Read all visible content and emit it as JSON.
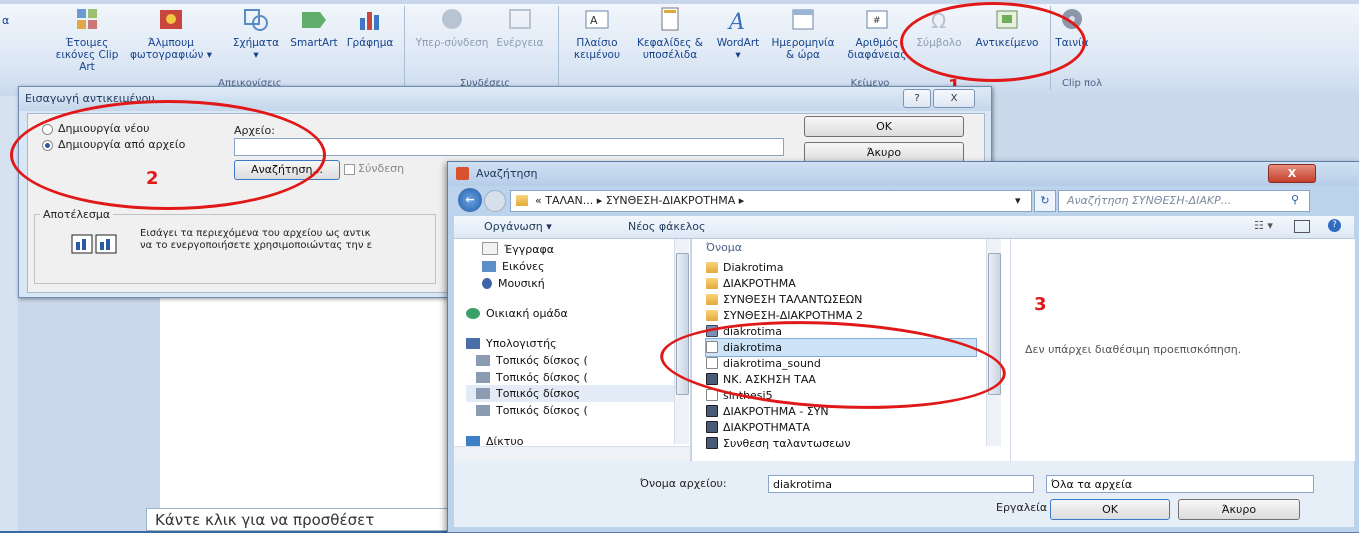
{
  "ribbon": {
    "items": [
      {
        "label": "Έτοιμες εικόνες Clip Art",
        "line1": "Έτοιμες",
        "line2": "εικόνες Clip Art"
      },
      {
        "label": "Άλμπουμ φωτογραφιών",
        "line1": "Άλμπουμ",
        "line2": "φωτογραφιών ▾"
      },
      {
        "label": "Σχήματα",
        "line1": "Σχήματα",
        "line2": "▾"
      },
      {
        "label": "SmartArt",
        "line1": "SmartArt",
        "line2": ""
      },
      {
        "label": "Γράφημα",
        "line1": "Γράφημα",
        "line2": ""
      },
      {
        "label": "Υπερ-σύνδεση",
        "line1": "Υπερ-σύνδεση",
        "line2": ""
      },
      {
        "label": "Ενέργεια",
        "line1": "Ενέργεια",
        "line2": ""
      },
      {
        "label": "Πλαίσιο κειμένου",
        "line1": "Πλαίσιο",
        "line2": "κειμένου"
      },
      {
        "label": "Κεφαλίδες & υποσέλιδα",
        "line1": "Κεφαλίδες &",
        "line2": "υποσέλιδα"
      },
      {
        "label": "WordArt",
        "line1": "WordArt",
        "line2": "▾"
      },
      {
        "label": "Ημερομηνία & ώρα",
        "line1": "Ημερομηνία",
        "line2": "& ώρα"
      },
      {
        "label": "Αριθμός διαφάνειας",
        "line1": "Αριθμός",
        "line2": "διαφάνειας"
      },
      {
        "label": "Σύμβολο",
        "line1": "Σύμβολο",
        "line2": ""
      },
      {
        "label": "Αντικείμενο",
        "line1": "Αντικείμενο",
        "line2": ""
      },
      {
        "label": "Ταινία",
        "line1": "Ταινία",
        "line2": ""
      }
    ],
    "groups": {
      "illustrations": "Απεικονίσεις",
      "links": "Συνδέσεις",
      "text": "Κείμενο",
      "media": "Clip πολ"
    },
    "left_cut": "α"
  },
  "annotations": {
    "one": "1",
    "two": "2",
    "three": "3"
  },
  "insert_object_dialog": {
    "title": "Εισαγωγή αντικειμένου",
    "help_btn": "?",
    "close_btn": "X",
    "create_new": "Δημιουργία νέου",
    "create_from_file": "Δημιουργία από αρχείο",
    "file_label": "Αρχείο:",
    "file_value": "",
    "browse": "Αναζήτηση...",
    "link": "Σύνδεση",
    "ok": "OK",
    "cancel": "Άκυρο",
    "result_label": "Αποτέλεσμα",
    "result_line1": "Εισάγει τα περιεχόμενα του αρχείου ως αντικ",
    "result_line2": "να το ενεργοποιήσετε χρησιμοποιώντας την ε"
  },
  "slide": {
    "placeholder": "Κάντε κλικ για να προσθέσετ"
  },
  "browse_dialog": {
    "title": "Αναζήτηση",
    "path": "« ΤΑΛΑΝ... ▸ ΣΥΝΘΕΣΗ-ΔΙΑΚΡΟΤΗΜΑ ▸",
    "search_placeholder": "Αναζήτηση ΣΥΝΘΕΣΗ-ΔΙΑΚΡ...",
    "organize": "Οργάνωση ▾",
    "new_folder": "Νέος φάκελος",
    "nav": [
      {
        "label": "Έγγραφα",
        "icon": "documents-icon"
      },
      {
        "label": "Εικόνες",
        "icon": "pictures-icon"
      },
      {
        "label": "Μουσική",
        "icon": "music-icon"
      },
      {
        "label": "Οικιακή ομάδα",
        "icon": "homegroup-icon"
      },
      {
        "label": "Υπολογιστής",
        "icon": "computer-icon"
      },
      {
        "label": "Τοπικός δίσκος (",
        "icon": "drive-icon"
      },
      {
        "label": "Τοπικός δίσκος (",
        "icon": "drive-icon"
      },
      {
        "label": "Τοπικός δίσκος",
        "icon": "drive-icon"
      },
      {
        "label": "Τοπικός δίσκος (",
        "icon": "drive-icon"
      },
      {
        "label": "Δίκτυο",
        "icon": "network-icon"
      }
    ],
    "column_name": "Όνομα",
    "files": [
      {
        "name": "Diakrotima",
        "type": "folder"
      },
      {
        "name": "ΔΙΑΚΡΟΤΗΜΑ",
        "type": "folder"
      },
      {
        "name": "ΣΥΝΘΕΣΗ ΤΑΛΑΝΤΩΣΕΩΝ",
        "type": "folder"
      },
      {
        "name": "ΣΥΝΘΕΣΗ-ΔΙΑΚΡΟΤΗΜΑ 2",
        "type": "folder"
      },
      {
        "name": "diakrotima",
        "type": "app"
      },
      {
        "name": "diakrotima",
        "type": "doc"
      },
      {
        "name": "diakrotima_sound",
        "type": "doc"
      },
      {
        "name": "ΝΚ. ΑΣΚΗΣΗ ΤΑΑ",
        "type": "media"
      },
      {
        "name": "sinthesi5",
        "type": "doc"
      },
      {
        "name": "ΔΙΑΚΡΟΤΗΜΑ - ΣΥΝ",
        "type": "media"
      },
      {
        "name": "ΔΙΑΚΡΟΤΗΜΑΤΑ",
        "type": "media"
      },
      {
        "name": "Συνθεση ταλαντωσεων",
        "type": "media"
      }
    ],
    "selected_index": 5,
    "no_preview": "Δεν υπάρχει διαθέσιμη προεπισκόπηση.",
    "filename_label": "Όνομα αρχείου:",
    "filename_value": "diakrotima",
    "filter_value": "Όλα τα αρχεία",
    "tools": "Εργαλεία",
    "ok": "OK",
    "cancel": "Άκυρο",
    "close_btn": "X"
  },
  "colors": {
    "annotation": "#e01818",
    "selection": "#cde3f7",
    "ribbon_text": "#15428b"
  }
}
